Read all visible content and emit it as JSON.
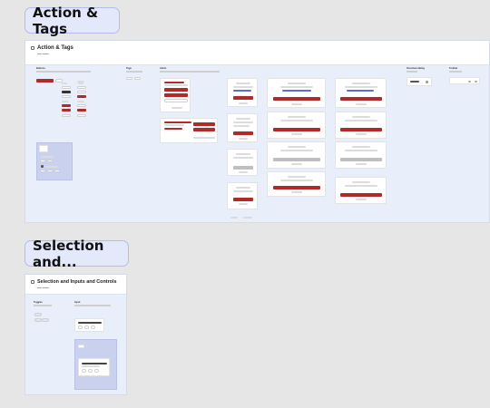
{
  "sections": [
    {
      "tag": "Action & Tags",
      "title": "Action & Tags"
    },
    {
      "tag": "Selection and...",
      "title": "Selection and Inputs and Controls"
    }
  ],
  "columns_top": [
    {
      "name": "Buttons"
    },
    {
      "name": "Tags"
    },
    {
      "name": "Alerts"
    },
    {
      "name": "Overview dialog"
    },
    {
      "name": "Toolbar"
    }
  ],
  "columns_bottom": [
    {
      "name": "Toggles"
    },
    {
      "name": "Input"
    }
  ],
  "colors": {
    "accent": "#b02a2a",
    "frame_bg": "#e9eefb",
    "tag_bg": "#e4e8fb",
    "canvas": "#e6e6e6"
  }
}
